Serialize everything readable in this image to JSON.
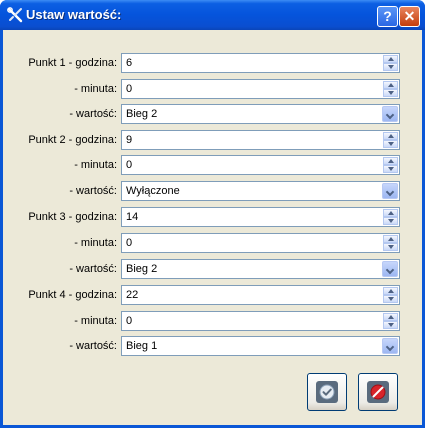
{
  "window": {
    "title": "Ustaw wartość:"
  },
  "titlebar": {
    "help_label": "?",
    "close_label": "✕"
  },
  "rows": [
    {
      "label": "Punkt 1 - godzina:",
      "value": "6",
      "control": "spin"
    },
    {
      "label": "- minuta:",
      "value": "0",
      "control": "spin"
    },
    {
      "label": "- wartość:",
      "value": "Bieg 2",
      "control": "dropdown"
    },
    {
      "label": "Punkt 2 - godzina:",
      "value": "9",
      "control": "spin"
    },
    {
      "label": "- minuta:",
      "value": "0",
      "control": "spin"
    },
    {
      "label": "- wartość:",
      "value": "Wyłączone",
      "control": "dropdown"
    },
    {
      "label": "Punkt 3 - godzina:",
      "value": "14",
      "control": "spin"
    },
    {
      "label": "- minuta:",
      "value": "0",
      "control": "spin"
    },
    {
      "label": "- wartość:",
      "value": "Bieg 2",
      "control": "dropdown"
    },
    {
      "label": "Punkt 4 - godzina:",
      "value": "22",
      "control": "spin"
    },
    {
      "label": "- minuta:",
      "value": "0",
      "control": "spin"
    },
    {
      "label": "- wartość:",
      "value": "Bieg 1",
      "control": "dropdown"
    }
  ],
  "icons": {
    "title": "tools-icon",
    "ok": "check-icon",
    "cancel": "cancel-icon"
  }
}
